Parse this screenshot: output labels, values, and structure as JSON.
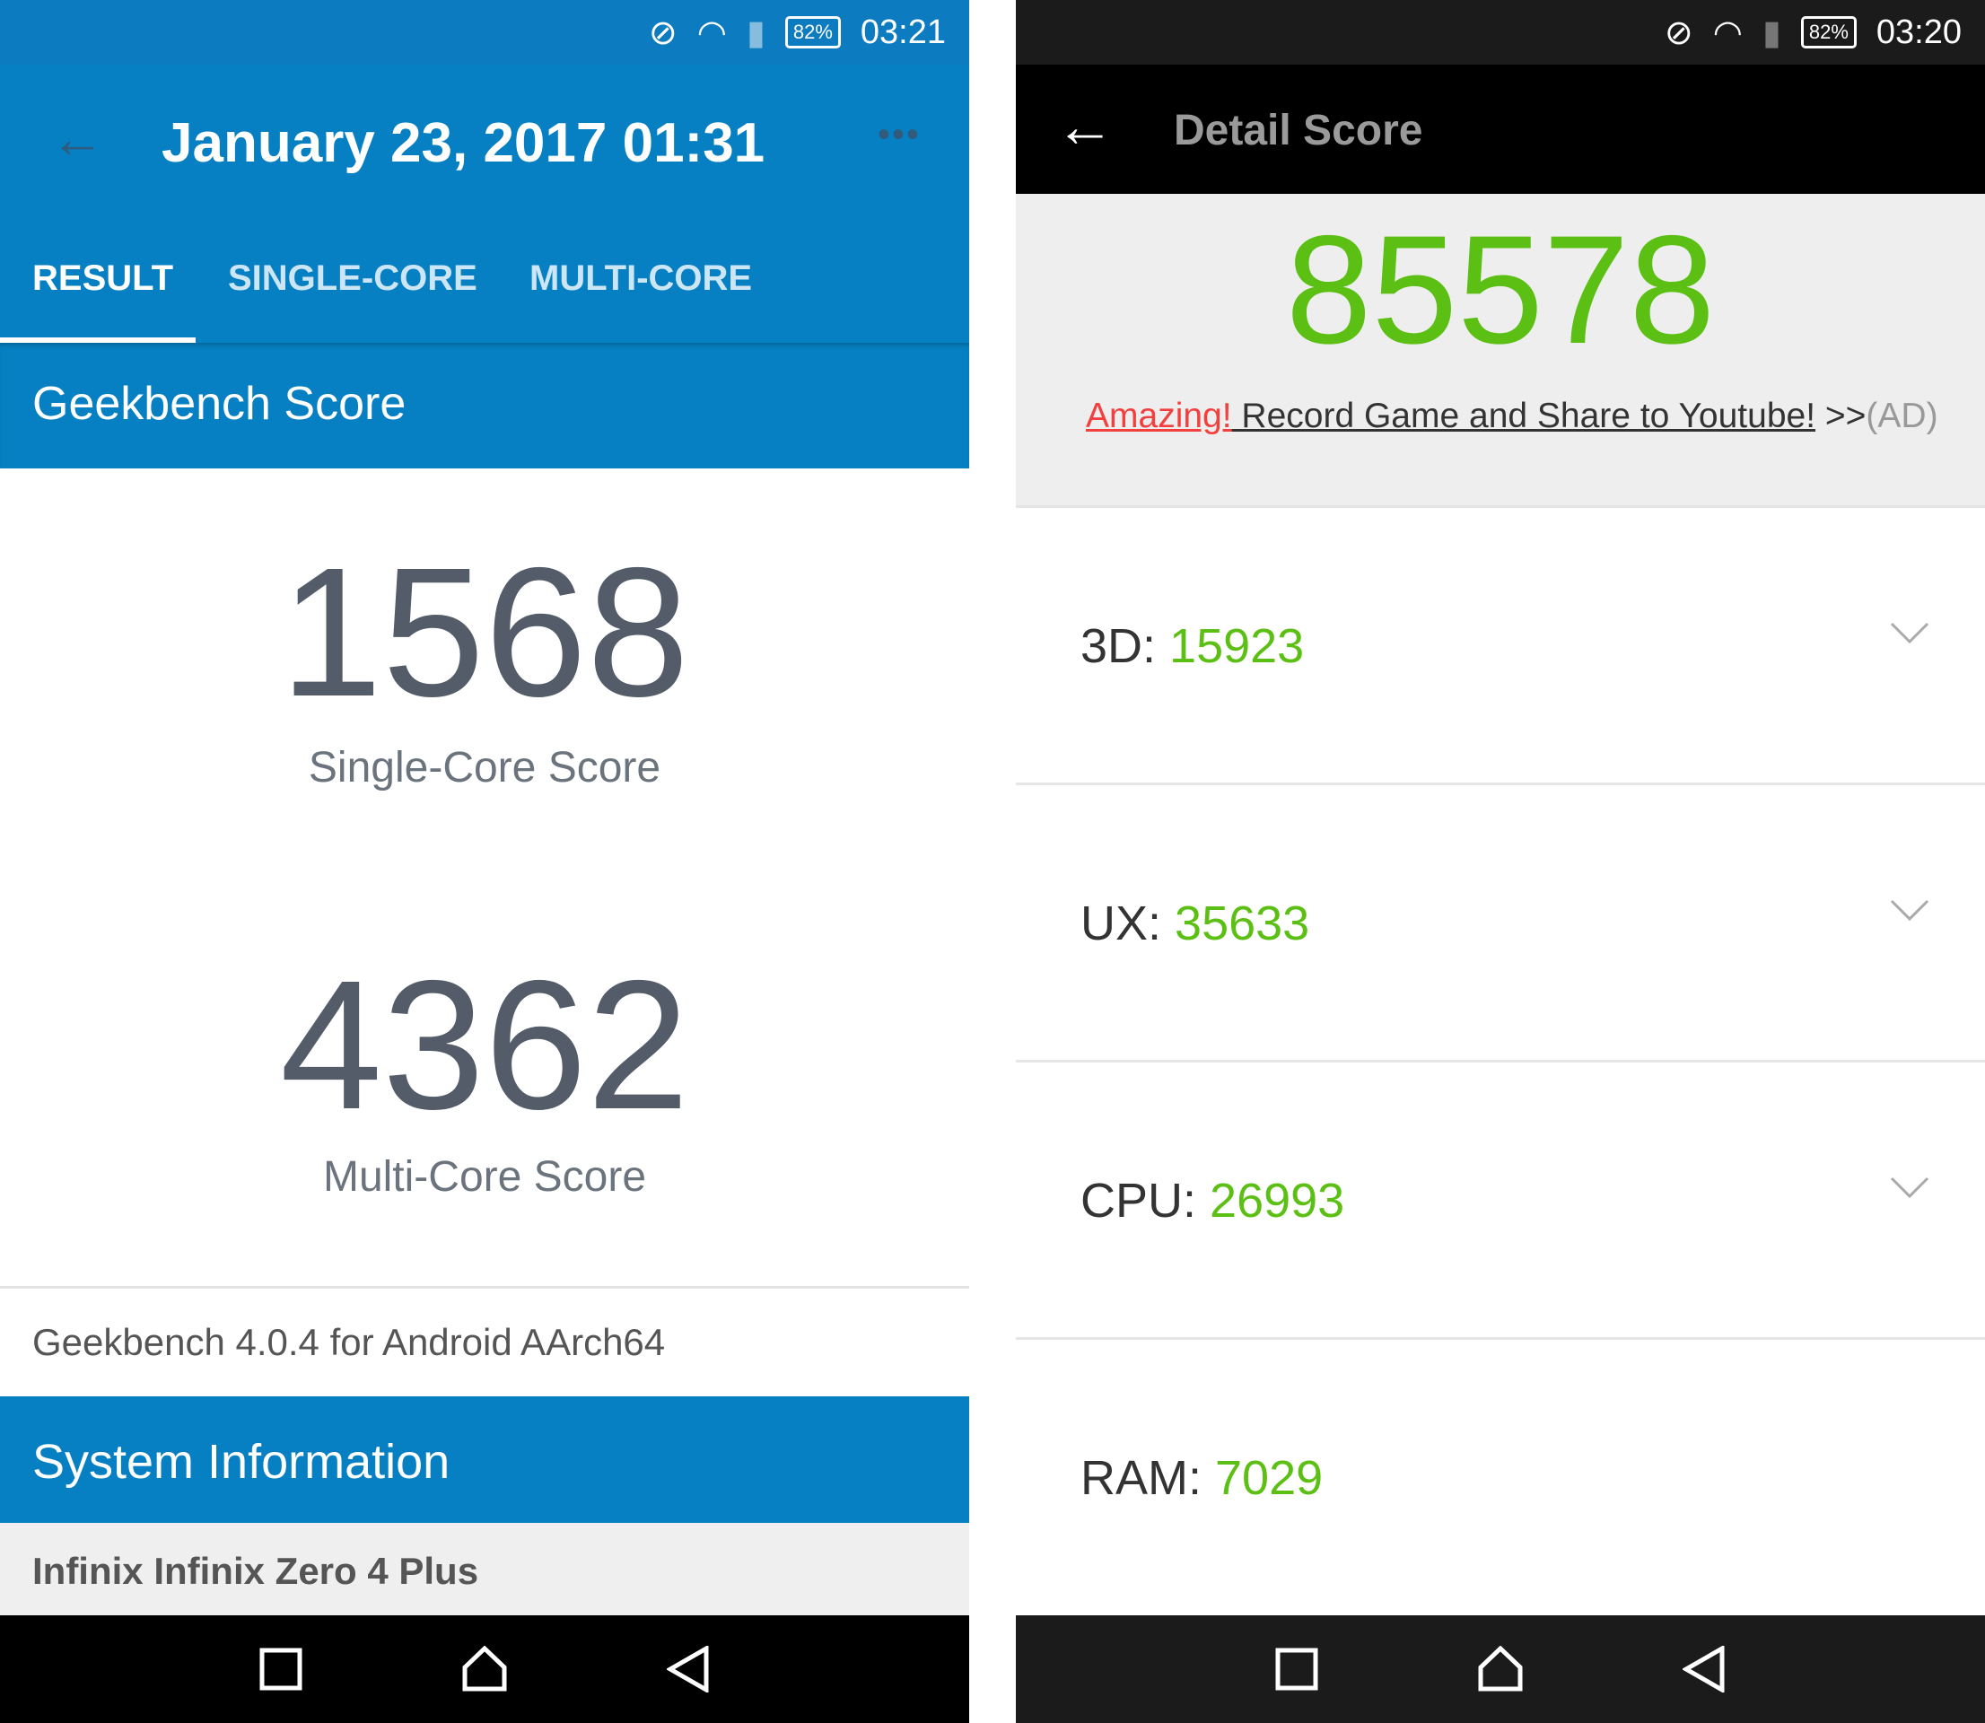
{
  "left": {
    "status": {
      "time": "03:21",
      "battery": "82%"
    },
    "title": "January 23, 2017 01:31",
    "tabs": [
      {
        "label": "RESULT",
        "active": true
      },
      {
        "label": "SINGLE-CORE"
      },
      {
        "label": "MULTI-CORE"
      }
    ],
    "section_title": "Geekbench Score",
    "single_core": {
      "value": "1568",
      "label": "Single-Core Score"
    },
    "multi_core": {
      "value": "4362",
      "label": "Multi-Core Score"
    },
    "version": "Geekbench 4.0.4 for Android AArch64",
    "system_info_title": "System Information",
    "device": "Infinix Infinix Zero 4 Plus"
  },
  "right": {
    "status": {
      "time": "03:20",
      "battery": "82%"
    },
    "title": "Detail Score",
    "total": "85578",
    "ad": {
      "highlight": "Amazing!",
      "text": " Record Game and Share to Youtube!",
      "arrow": " >>",
      "tag": "(AD)"
    },
    "rows": [
      {
        "label": "3D: ",
        "value": "15923"
      },
      {
        "label": "UX: ",
        "value": "35633"
      },
      {
        "label": "CPU: ",
        "value": "26993"
      },
      {
        "label": "RAM: ",
        "value": "7029"
      }
    ]
  },
  "colors": {
    "geekbench_blue": "#0680c2",
    "antutu_green": "#5cbf14",
    "ad_red": "#f2403f"
  }
}
